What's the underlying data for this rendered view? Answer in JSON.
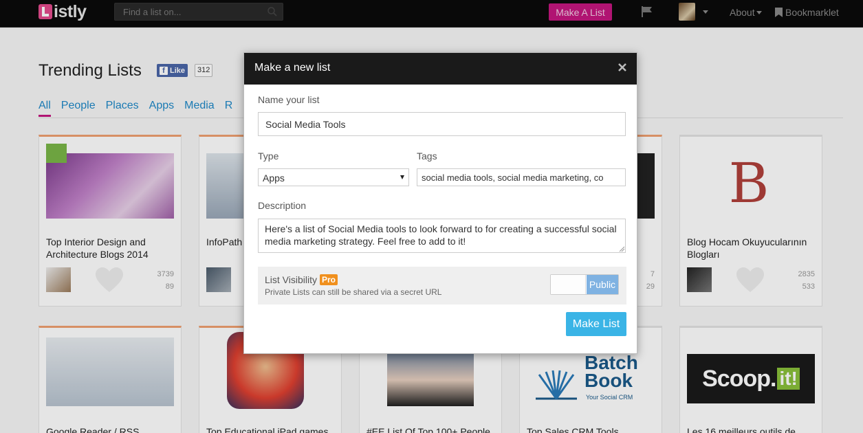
{
  "topbar": {
    "logo_text": "istly",
    "search_placeholder": "Find a list on...",
    "make_list_label": "Make A List",
    "about_label": "About",
    "bookmarklet_label": "Bookmarklet"
  },
  "page": {
    "title": "Trending Lists",
    "fb_like_label": "Like",
    "fb_count": "312",
    "tabs": [
      "All",
      "People",
      "Places",
      "Apps",
      "Media",
      "R"
    ],
    "active_tab": "All",
    "cards_row1": [
      {
        "title": "Top Interior Design and Architecture Blogs 2014",
        "views": "3739",
        "comments": "89"
      },
      {
        "title": "InfoPath",
        "views": "",
        "comments": ""
      },
      {
        "title": "",
        "views": "7",
        "comments": "29"
      },
      {
        "title": "Blog Hocam Okuyucularının Blogları",
        "views": "2835",
        "comments": "533"
      }
    ],
    "cards_row2": [
      {
        "title": "Google Reader / RSS"
      },
      {
        "title": "Top Educational iPad games"
      },
      {
        "title": "#EE List Of Top 100+ People"
      },
      {
        "title": "Top Sales CRM Tools"
      },
      {
        "title": "Les 16 meilleurs outils de"
      }
    ],
    "card_image_texts": {
      "batchbook_line1": "Batch",
      "batchbook_line2": "Book",
      "batchbook_tagline": "Your Social CRM",
      "scoopit": "Scoop.",
      "scoopit_suffix": "it!",
      "letter_b": "B"
    }
  },
  "modal": {
    "title": "Make a new list",
    "name_label": "Name your list",
    "name_value": "Social Media Tools",
    "type_label": "Type",
    "type_value": "Apps",
    "tags_label": "Tags",
    "tags_value": "social media tools, social media marketing, co",
    "description_label": "Description",
    "description_value": "Here's a list of Social Media tools to look forward to for creating a successful social media marketing strategy. Feel free to add to it!",
    "visibility_label": "List Visibility",
    "pro_badge": "Pro",
    "visibility_note": "Private Lists can still be shared via a secret URL",
    "visibility_state": "Public",
    "submit_label": "Make List"
  },
  "colors": {
    "brand_pink": "#c4177f",
    "submit_blue": "#3ab4e6",
    "toggle_blue": "#7fb2e2",
    "pro_orange": "#f0901e",
    "link_blue": "#1e88c8"
  }
}
